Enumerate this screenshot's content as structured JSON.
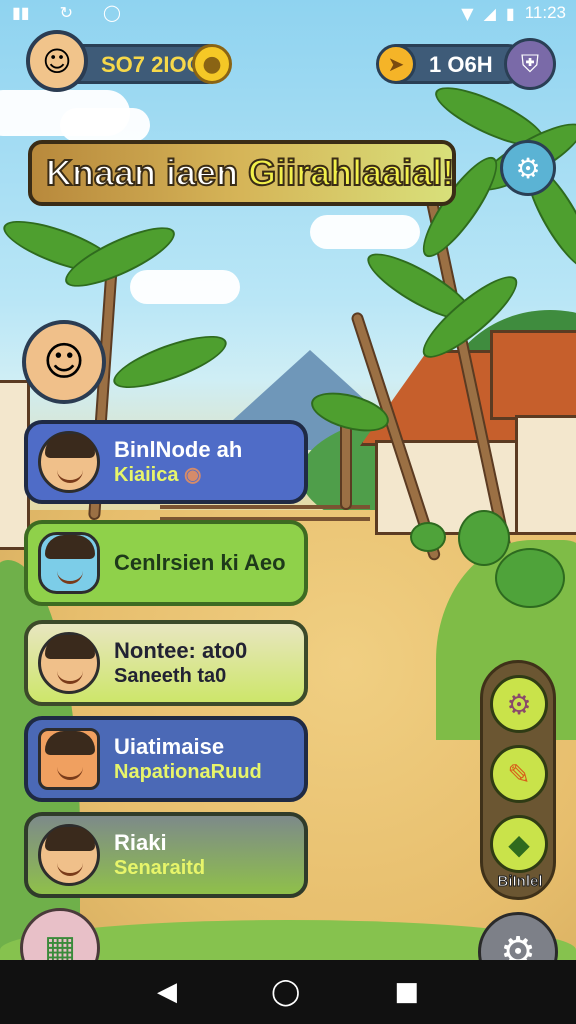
{
  "status_bar": {
    "time": "11:23",
    "icons": [
      "notification-icon",
      "sync-icon",
      "data-icon",
      "wifi-icon",
      "signal-icon",
      "battery-icon"
    ]
  },
  "hud": {
    "coins": "SO7 2IOO",
    "gems": "1 O6H"
  },
  "banner": {
    "title_part1": "Knaan iaen",
    "title_part2": "Giirahlaaial!"
  },
  "menu": [
    {
      "title": "BinlNode ah",
      "subtitle": "Kiaiica",
      "bg": "#4f6cc7",
      "icon": "boy-face-icon"
    },
    {
      "title": "Cenlrsien ki Aeo",
      "subtitle": "",
      "bg": "#8fd14a",
      "icon": "blue-creature-icon"
    },
    {
      "title": "Nontee: ato0",
      "subtitle": "Saneeth ta0",
      "bg": "#e6ecb2",
      "icon": "girl-face-icon"
    },
    {
      "title": "Uiatimaise",
      "subtitle": "NapationaRuud",
      "bg": "#4b69b6",
      "icon": "cap-boy-icon"
    },
    {
      "title": "Riaki",
      "subtitle": "Senaraitd",
      "bg": "#7a8a8a",
      "icon": "boy-face-icon"
    }
  ],
  "tools": {
    "label": "BiInlel",
    "items": [
      "gear-icon",
      "pencil-icon",
      "map-icon"
    ]
  },
  "colors": {
    "sky": "#8fd3f0",
    "ground": "#e7be6d",
    "card_dark": "#1f2a44",
    "tool_green": "#c9e34a",
    "hud_pill": "#3e5b78",
    "coin": "#f5c826"
  }
}
